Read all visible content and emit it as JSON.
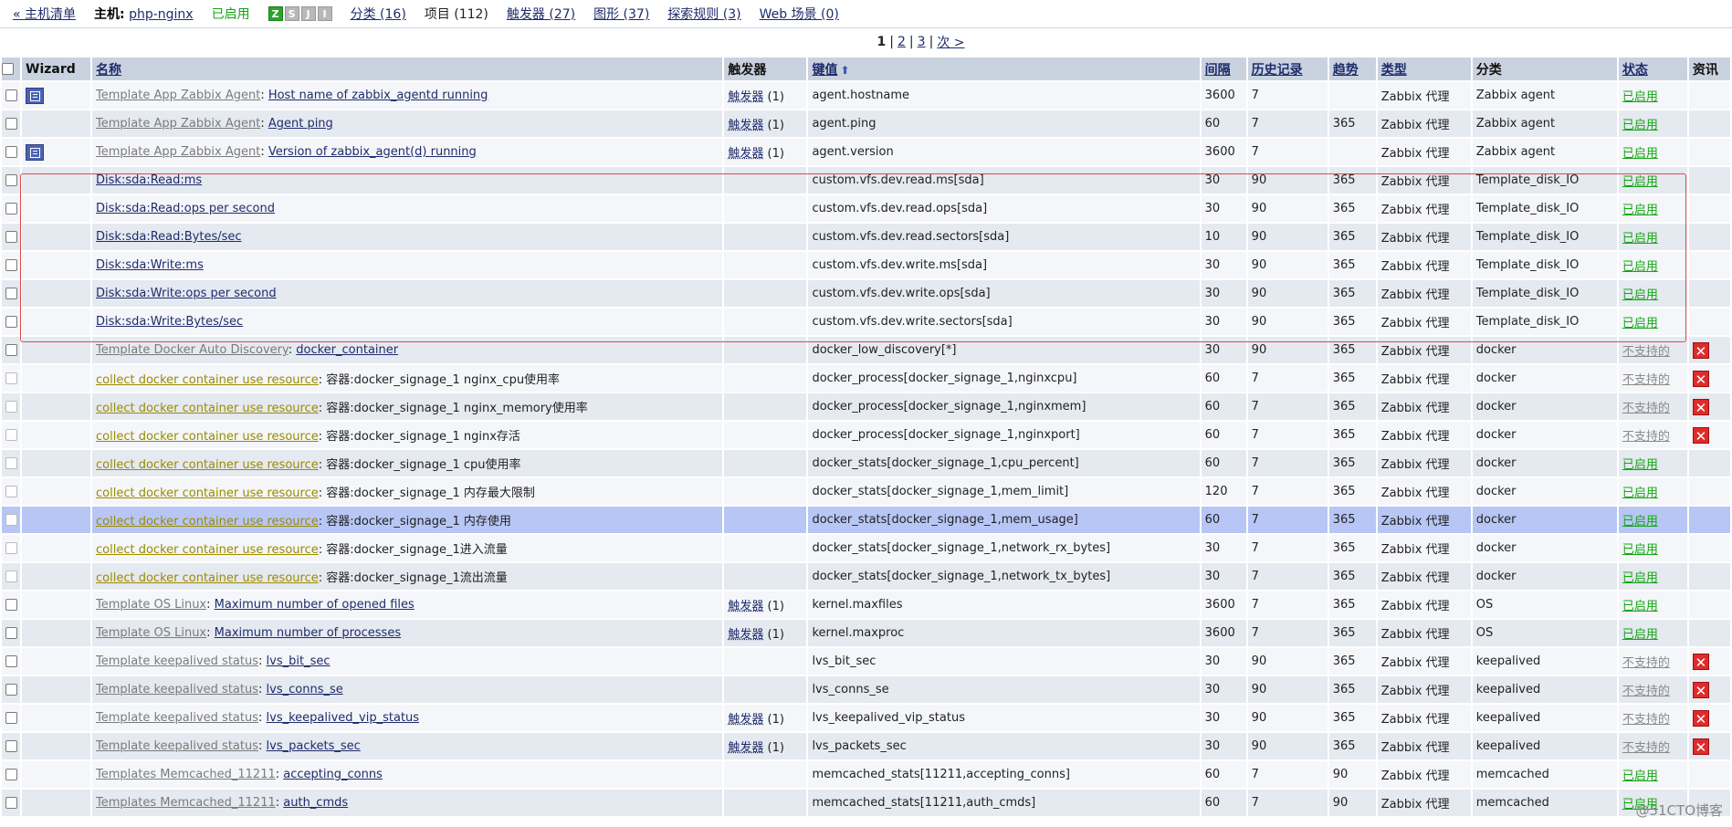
{
  "topbar": {
    "back": "« 主机清单",
    "host_label": "主机:",
    "host_name": "php-nginx",
    "host_status": "已启用",
    "availability": [
      "Z",
      "S",
      "J",
      "I"
    ],
    "applications": "分类 (16)",
    "items": "项目 (112)",
    "triggers": "触发器 (27)",
    "graphs": "图形 (37)",
    "discovery": "探索规则 (3)",
    "web": "Web 场景 (0)"
  },
  "pager": {
    "current": "1",
    "pages": [
      "2",
      "3"
    ],
    "next": "次 >"
  },
  "columns": {
    "wizard": "Wizard",
    "name": "名称",
    "triggers": "触发器",
    "key": "键值",
    "interval": "间隔",
    "history": "历史记录",
    "trends": "趋势",
    "type": "类型",
    "application": "分类",
    "status": "状态",
    "info": "资讯"
  },
  "rows": [
    {
      "wiz": true,
      "tpl": "Template App Zabbix Agent",
      "tpl_style": "gray",
      "name": "Host name of zabbix_agentd running",
      "name_link": true,
      "trig": "触发器",
      "trig_count": "(1)",
      "key": "agent.hostname",
      "interval": "3600",
      "history": "7",
      "trends": "",
      "type": "Zabbix 代理",
      "app": "Zabbix agent",
      "status": "已启用",
      "status_kind": "on",
      "err": false
    },
    {
      "wiz": false,
      "tpl": "Template App Zabbix Agent",
      "tpl_style": "gray",
      "name": "Agent ping",
      "name_link": true,
      "trig": "触发器",
      "trig_count": "(1)",
      "key": "agent.ping",
      "interval": "60",
      "history": "7",
      "trends": "365",
      "type": "Zabbix 代理",
      "app": "Zabbix agent",
      "status": "已启用",
      "status_kind": "on",
      "err": false
    },
    {
      "wiz": true,
      "tpl": "Template App Zabbix Agent",
      "tpl_style": "gray",
      "name": "Version of zabbix_agent(d) running",
      "name_link": true,
      "trig": "触发器",
      "trig_count": "(1)",
      "key": "agent.version",
      "interval": "3600",
      "history": "7",
      "trends": "",
      "type": "Zabbix 代理",
      "app": "Zabbix agent",
      "status": "已启用",
      "status_kind": "on",
      "err": false
    },
    {
      "wiz": false,
      "tpl": "",
      "tpl_style": "",
      "name": "Disk:sda:Read:ms",
      "name_link": true,
      "trig": "",
      "trig_count": "",
      "key": "custom.vfs.dev.read.ms[sda]",
      "interval": "30",
      "history": "90",
      "trends": "365",
      "type": "Zabbix 代理",
      "app": "Template_disk_IO",
      "status": "已启用",
      "status_kind": "on",
      "err": false
    },
    {
      "wiz": false,
      "tpl": "",
      "tpl_style": "",
      "name": "Disk:sda:Read:ops per second",
      "name_link": true,
      "trig": "",
      "trig_count": "",
      "key": "custom.vfs.dev.read.ops[sda]",
      "interval": "30",
      "history": "90",
      "trends": "365",
      "type": "Zabbix 代理",
      "app": "Template_disk_IO",
      "status": "已启用",
      "status_kind": "on",
      "err": false
    },
    {
      "wiz": false,
      "tpl": "",
      "tpl_style": "",
      "name": "Disk:sda:Read:Bytes/sec",
      "name_link": true,
      "trig": "",
      "trig_count": "",
      "key": "custom.vfs.dev.read.sectors[sda]",
      "interval": "10",
      "history": "90",
      "trends": "365",
      "type": "Zabbix 代理",
      "app": "Template_disk_IO",
      "status": "已启用",
      "status_kind": "on",
      "err": false
    },
    {
      "wiz": false,
      "tpl": "",
      "tpl_style": "",
      "name": "Disk:sda:Write:ms",
      "name_link": true,
      "trig": "",
      "trig_count": "",
      "key": "custom.vfs.dev.write.ms[sda]",
      "interval": "30",
      "history": "90",
      "trends": "365",
      "type": "Zabbix 代理",
      "app": "Template_disk_IO",
      "status": "已启用",
      "status_kind": "on",
      "err": false
    },
    {
      "wiz": false,
      "tpl": "",
      "tpl_style": "",
      "name": "Disk:sda:Write:ops per second",
      "name_link": true,
      "trig": "",
      "trig_count": "",
      "key": "custom.vfs.dev.write.ops[sda]",
      "interval": "30",
      "history": "90",
      "trends": "365",
      "type": "Zabbix 代理",
      "app": "Template_disk_IO",
      "status": "已启用",
      "status_kind": "on",
      "err": false
    },
    {
      "wiz": false,
      "tpl": "",
      "tpl_style": "",
      "name": "Disk:sda:Write:Bytes/sec",
      "name_link": true,
      "trig": "",
      "trig_count": "",
      "key": "custom.vfs.dev.write.sectors[sda]",
      "interval": "30",
      "history": "90",
      "trends": "365",
      "type": "Zabbix 代理",
      "app": "Template_disk_IO",
      "status": "已启用",
      "status_kind": "on",
      "err": false
    },
    {
      "wiz": false,
      "tpl": "Template Docker Auto Discovery",
      "tpl_style": "gray",
      "name": "docker_container",
      "name_link": true,
      "trig": "",
      "trig_count": "",
      "key": "docker_low_discovery[*]",
      "interval": "30",
      "history": "90",
      "trends": "365",
      "type": "Zabbix 代理",
      "app": "docker",
      "status": "不支持的",
      "status_kind": "unsup",
      "err": true
    },
    {
      "wiz": false,
      "tpl": "collect docker container use resource",
      "tpl_style": "yellow",
      "name": "容器:docker_signage_1 nginx_cpu使用率",
      "name_link": false,
      "trig": "",
      "trig_count": "",
      "key": "docker_process[docker_signage_1,nginxcpu]",
      "interval": "60",
      "history": "7",
      "trends": "365",
      "type": "Zabbix 代理",
      "app": "docker",
      "status": "不支持的",
      "status_kind": "unsup",
      "err": true
    },
    {
      "wiz": false,
      "tpl": "collect docker container use resource",
      "tpl_style": "yellow",
      "name": "容器:docker_signage_1 nginx_memory使用率",
      "name_link": false,
      "trig": "",
      "trig_count": "",
      "key": "docker_process[docker_signage_1,nginxmem]",
      "interval": "60",
      "history": "7",
      "trends": "365",
      "type": "Zabbix 代理",
      "app": "docker",
      "status": "不支持的",
      "status_kind": "unsup",
      "err": true
    },
    {
      "wiz": false,
      "tpl": "collect docker container use resource",
      "tpl_style": "yellow",
      "name": "容器:docker_signage_1 nginx存活",
      "name_link": false,
      "trig": "",
      "trig_count": "",
      "key": "docker_process[docker_signage_1,nginxport]",
      "interval": "60",
      "history": "7",
      "trends": "365",
      "type": "Zabbix 代理",
      "app": "docker",
      "status": "不支持的",
      "status_kind": "unsup",
      "err": true
    },
    {
      "wiz": false,
      "tpl": "collect docker container use resource",
      "tpl_style": "yellow",
      "name": "容器:docker_signage_1 cpu使用率",
      "name_link": false,
      "trig": "",
      "trig_count": "",
      "key": "docker_stats[docker_signage_1,cpu_percent]",
      "interval": "60",
      "history": "7",
      "trends": "365",
      "type": "Zabbix 代理",
      "app": "docker",
      "status": "已启用",
      "status_kind": "on",
      "err": false
    },
    {
      "wiz": false,
      "tpl": "collect docker container use resource",
      "tpl_style": "yellow",
      "name": "容器:docker_signage_1 内存最大限制",
      "name_link": false,
      "trig": "",
      "trig_count": "",
      "key": "docker_stats[docker_signage_1,mem_limit]",
      "interval": "120",
      "history": "7",
      "trends": "365",
      "type": "Zabbix 代理",
      "app": "docker",
      "status": "已启用",
      "status_kind": "on",
      "err": false
    },
    {
      "wiz": false,
      "tpl": "collect docker container use resource",
      "tpl_style": "yellow",
      "name": "容器:docker_signage_1 内存使用",
      "name_link": false,
      "trig": "",
      "trig_count": "",
      "key": "docker_stats[docker_signage_1,mem_usage]",
      "interval": "60",
      "history": "7",
      "trends": "365",
      "type": "Zabbix 代理",
      "app": "docker",
      "status": "已启用",
      "status_kind": "on",
      "err": false,
      "selected": true
    },
    {
      "wiz": false,
      "tpl": "collect docker container use resource",
      "tpl_style": "yellow",
      "name": "容器:docker_signage_1进入流量",
      "name_link": false,
      "trig": "",
      "trig_count": "",
      "key": "docker_stats[docker_signage_1,network_rx_bytes]",
      "interval": "30",
      "history": "7",
      "trends": "365",
      "type": "Zabbix 代理",
      "app": "docker",
      "status": "已启用",
      "status_kind": "on",
      "err": false
    },
    {
      "wiz": false,
      "tpl": "collect docker container use resource",
      "tpl_style": "yellow",
      "name": "容器:docker_signage_1流出流量",
      "name_link": false,
      "trig": "",
      "trig_count": "",
      "key": "docker_stats[docker_signage_1,network_tx_bytes]",
      "interval": "30",
      "history": "7",
      "trends": "365",
      "type": "Zabbix 代理",
      "app": "docker",
      "status": "已启用",
      "status_kind": "on",
      "err": false
    },
    {
      "wiz": false,
      "tpl": "Template OS Linux",
      "tpl_style": "gray",
      "name": "Maximum number of opened files",
      "name_link": true,
      "trig": "触发器",
      "trig_count": "(1)",
      "key": "kernel.maxfiles",
      "interval": "3600",
      "history": "7",
      "trends": "365",
      "type": "Zabbix 代理",
      "app": "OS",
      "status": "已启用",
      "status_kind": "on",
      "err": false
    },
    {
      "wiz": false,
      "tpl": "Template OS Linux",
      "tpl_style": "gray",
      "name": "Maximum number of processes",
      "name_link": true,
      "trig": "触发器",
      "trig_count": "(1)",
      "key": "kernel.maxproc",
      "interval": "3600",
      "history": "7",
      "trends": "365",
      "type": "Zabbix 代理",
      "app": "OS",
      "status": "已启用",
      "status_kind": "on",
      "err": false
    },
    {
      "wiz": false,
      "tpl": "Template keepalived status",
      "tpl_style": "gray",
      "name": "lvs_bit_sec",
      "name_link": true,
      "trig": "",
      "trig_count": "",
      "key": "lvs_bit_sec",
      "interval": "30",
      "history": "90",
      "trends": "365",
      "type": "Zabbix 代理",
      "app": "keepalived",
      "status": "不支持的",
      "status_kind": "unsup",
      "err": true
    },
    {
      "wiz": false,
      "tpl": "Template keepalived status",
      "tpl_style": "gray",
      "name": "lvs_conns_se",
      "name_link": true,
      "trig": "",
      "trig_count": "",
      "key": "lvs_conns_se",
      "interval": "30",
      "history": "90",
      "trends": "365",
      "type": "Zabbix 代理",
      "app": "keepalived",
      "status": "不支持的",
      "status_kind": "unsup",
      "err": true
    },
    {
      "wiz": false,
      "tpl": "Template keepalived status",
      "tpl_style": "gray",
      "name": "lvs_keepalived_vip_status",
      "name_link": true,
      "trig": "触发器",
      "trig_count": "(1)",
      "key": "lvs_keepalived_vip_status",
      "interval": "30",
      "history": "90",
      "trends": "365",
      "type": "Zabbix 代理",
      "app": "keepalived",
      "status": "不支持的",
      "status_kind": "unsup",
      "err": true
    },
    {
      "wiz": false,
      "tpl": "Template keepalived status",
      "tpl_style": "gray",
      "name": "lvs_packets_sec",
      "name_link": true,
      "trig": "触发器",
      "trig_count": "(1)",
      "key": "lvs_packets_sec",
      "interval": "30",
      "history": "90",
      "trends": "365",
      "type": "Zabbix 代理",
      "app": "keepalived",
      "status": "不支持的",
      "status_kind": "unsup",
      "err": true
    },
    {
      "wiz": false,
      "tpl": "Templates Memcached_11211",
      "tpl_style": "gray",
      "name": "accepting_conns",
      "name_link": true,
      "trig": "",
      "trig_count": "",
      "key": "memcached_stats[11211,accepting_conns]",
      "interval": "60",
      "history": "7",
      "trends": "90",
      "type": "Zabbix 代理",
      "app": "memcached",
      "status": "已启用",
      "status_kind": "on",
      "err": false
    },
    {
      "wiz": false,
      "tpl": "Templates Memcached_11211",
      "tpl_style": "gray",
      "name": "auth_cmds",
      "name_link": true,
      "trig": "",
      "trig_count": "",
      "key": "memcached_stats[11211,auth_cmds]",
      "interval": "60",
      "history": "7",
      "trends": "90",
      "type": "Zabbix 代理",
      "app": "memcached",
      "status": "已启用",
      "status_kind": "on",
      "err": false
    }
  ],
  "watermark": "@51CTO博客"
}
